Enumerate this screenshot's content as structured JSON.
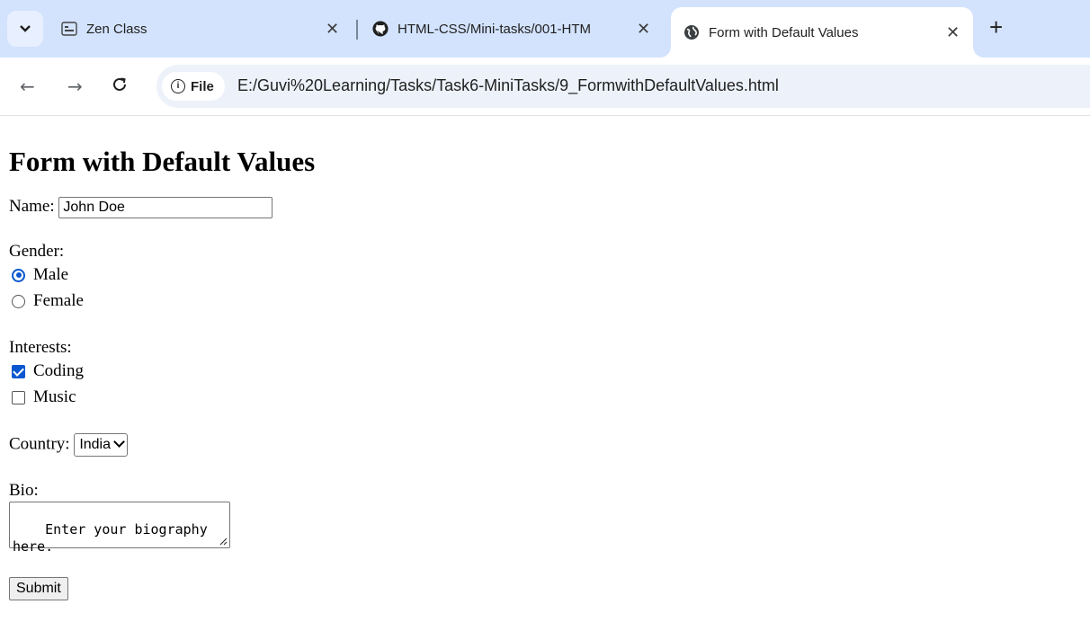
{
  "browser": {
    "tabs": [
      {
        "title": "Zen Class",
        "icon": "zen-class-icon"
      },
      {
        "title": "HTML-CSS/Mini-tasks/001-HTM",
        "icon": "github-icon"
      },
      {
        "title": "Form with Default Values",
        "icon": "globe-icon",
        "active": true
      }
    ],
    "new_tab": "+",
    "close_glyph": "✕",
    "nav": {
      "back": "←",
      "forward": "→",
      "reload": "C"
    },
    "chip_label": "File",
    "url": "E:/Guvi%20Learning/Tasks/Task6-MiniTasks/9_FormwithDefaultValues.html"
  },
  "form": {
    "title": "Form with Default Values",
    "name_label": "Name:",
    "name_value": "John Doe",
    "gender_label": "Gender:",
    "gender_options": [
      {
        "label": "Male",
        "checked": true
      },
      {
        "label": "Female",
        "checked": false
      }
    ],
    "interests_label": "Interests:",
    "interests": [
      {
        "label": "Coding",
        "checked": true
      },
      {
        "label": "Music",
        "checked": false
      }
    ],
    "country_label": "Country:",
    "country_selected": "India",
    "bio_label": "Bio:",
    "bio_value": "Enter your biography here.",
    "submit_label": "Submit"
  },
  "colors": {
    "accent": "#0b57d0",
    "tabstrip": "#d3e3fd",
    "omnibox": "#edf2fa"
  }
}
